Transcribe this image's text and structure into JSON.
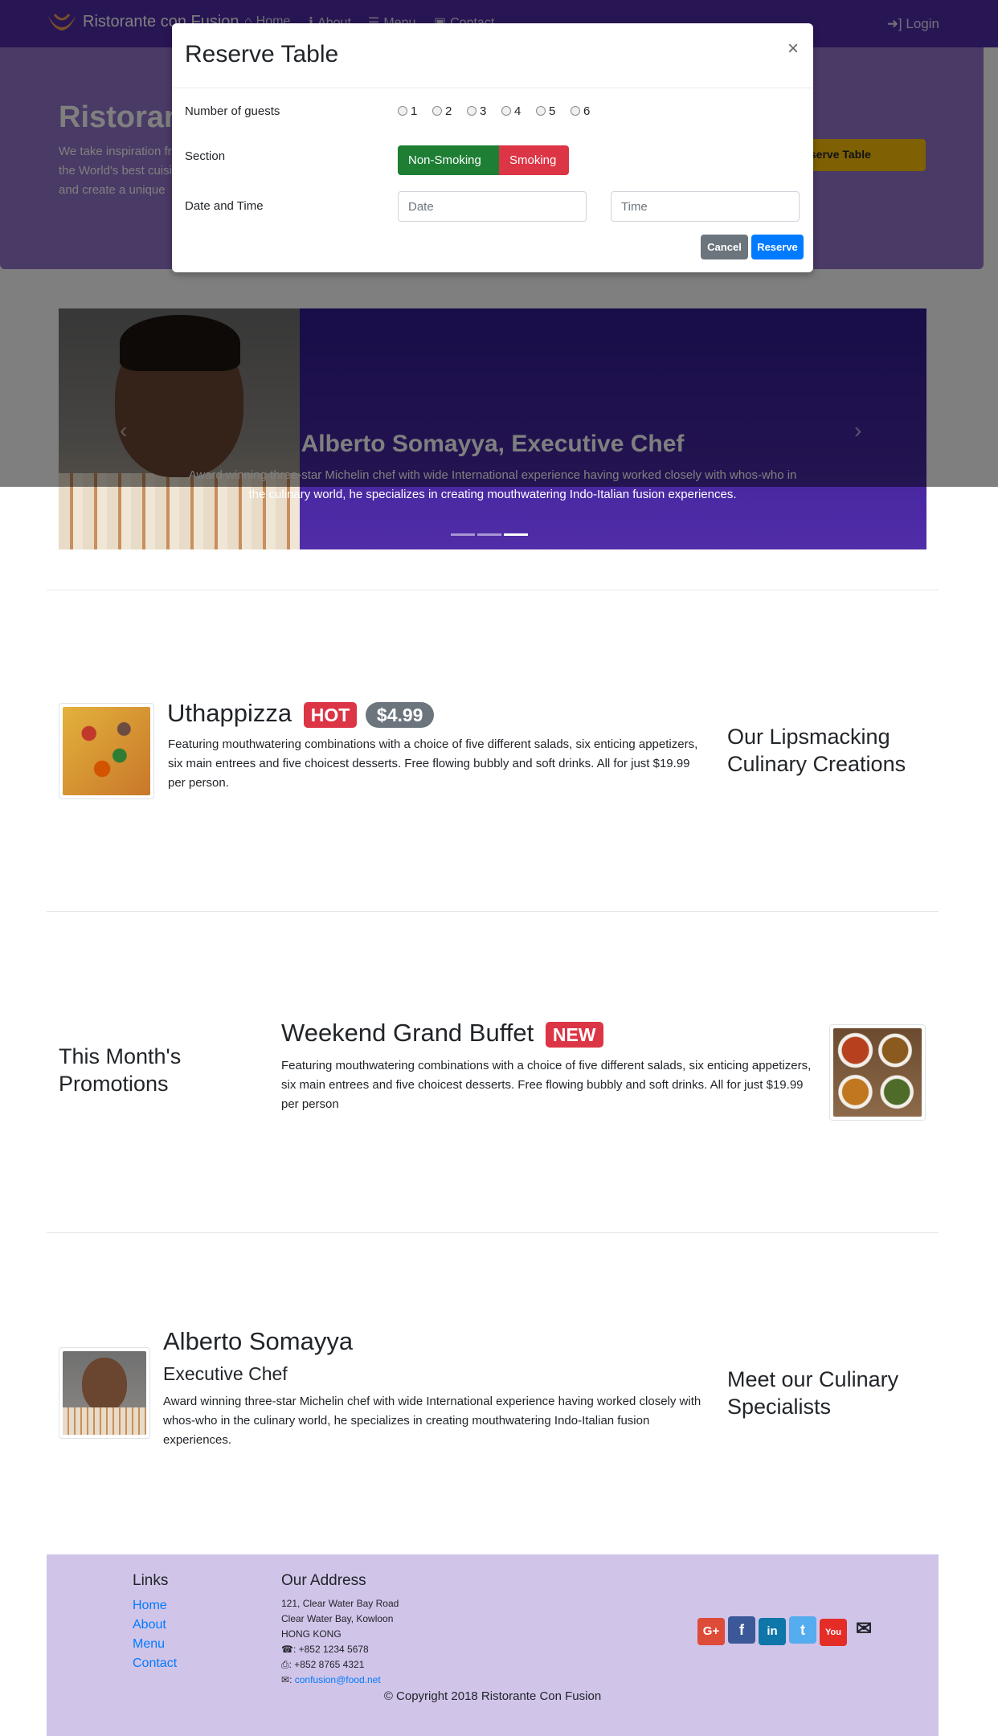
{
  "navbar": {
    "brand": "Ristorante con Fusion",
    "links": [
      {
        "label": "Home",
        "icon": "home-icon"
      },
      {
        "label": "About",
        "icon": "info-icon"
      },
      {
        "label": "Menu",
        "icon": "list-icon"
      },
      {
        "label": "Contact",
        "icon": "address-card-icon"
      }
    ],
    "login": "Login"
  },
  "jumbotron": {
    "title": "Ristorante con Fusion",
    "text": "We take inspiration from the World's best cuisines, and create a unique fusion experience. Our lipsmacking creations will tickle your culinary senses!",
    "button": "Reserve Table"
  },
  "carousel": {
    "title": "Alberto Somayya, Executive Chef",
    "text": "Award winning three-star Michelin chef with wide International experience having worked closely with whos-who in the culinary world, he specializes in creating mouthwatering Indo-Italian fusion experiences.",
    "slide_count": 3,
    "active_slide": 3
  },
  "dish": {
    "name": "Uthappizza",
    "badge": "HOT",
    "price": "$4.99",
    "description": "Featuring mouthwatering combinations with a choice of five different salads, six enticing appetizers, six main entrees and five choicest desserts. Free flowing bubbly and soft drinks. All for just $19.99 per person.",
    "section_heading": "Our Lipsmacking Culinary Creations"
  },
  "promotion": {
    "section_heading": "This Month's Promotions",
    "name": "Weekend Grand Buffet",
    "badge": "NEW",
    "description": "Featuring mouthwatering combinations with a choice of five different salads, six enticing appetizers, six main entrees and five choicest desserts. Free flowing bubbly and soft drinks. All for just $19.99 per person"
  },
  "leader": {
    "name": "Alberto Somayya",
    "designation": "Executive Chef",
    "description": "Award winning three-star Michelin chef with wide International experience having worked closely with whos-who in the culinary world, he specializes in creating mouthwatering Indo-Italian fusion experiences.",
    "section_heading": "Meet our Culinary Specialists"
  },
  "footer": {
    "links_heading": "Links",
    "links": [
      "Home",
      "About",
      "Menu",
      "Contact"
    ],
    "address_heading": "Our Address",
    "address": [
      "121, Clear Water Bay Road",
      "Clear Water Bay, Kowloon",
      "HONG KONG"
    ],
    "phone": ": +852 1234 5678",
    "fax": ": +852 8765 4321",
    "email": "confusion@food.net",
    "copyright": "© Copyright 2018 Ristorante Con Fusion"
  },
  "modal": {
    "title": "Reserve Table",
    "close": "×",
    "guests_label": "Number of guests",
    "guest_options": [
      "1",
      "2",
      "3",
      "4",
      "5",
      "6"
    ],
    "section_label": "Section",
    "section_options": [
      "Non-Smoking",
      "Smoking"
    ],
    "datetime_label": "Date and Time",
    "date_placeholder": "Date",
    "time_placeholder": "Time",
    "cancel": "Cancel",
    "reserve": "Reserve"
  },
  "colors": {
    "primary_dark": "#512DA8",
    "primary_light": "#9575CD",
    "footer_bg": "#D1C4E9",
    "accent": "#FFC107",
    "danger": "#dc3545",
    "success": "#1e7e34",
    "link": "#007bff"
  }
}
